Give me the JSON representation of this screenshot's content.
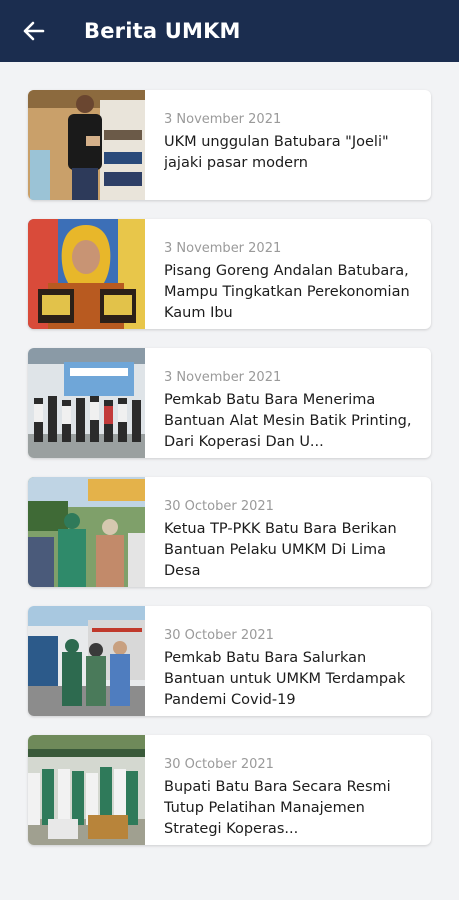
{
  "header": {
    "title": "Berita UMKM",
    "back_icon": "arrow-left-icon"
  },
  "colors": {
    "appbar": "#1b2d4f",
    "background": "#f2f3f5",
    "card": "#ffffff",
    "date_text": "#9a9a9a",
    "title_text": "#1c1c1c"
  },
  "news": [
    {
      "date": "3 November 2021",
      "title": "UKM unggulan Batubara \"Joeli\" jajaki pasar modern"
    },
    {
      "date": "3 November 2021",
      "title": "Pisang Goreng Andalan Batubara, Mampu Tingkatkan Perekonomian Kaum Ibu"
    },
    {
      "date": "3 November 2021",
      "title": "Pemkab Batu Bara Menerima Bantuan Alat Mesin Batik Printing, Dari Koperasi Dan U..."
    },
    {
      "date": "30 October 2021",
      "title": "Ketua TP-PKK Batu Bara Berikan Bantuan Pelaku UMKM Di Lima Desa"
    },
    {
      "date": "30 October 2021",
      "title": "Pemkab Batu Bara Salurkan Bantuan untuk UMKM Terdampak Pandemi Covid-19"
    },
    {
      "date": "30 October 2021",
      "title": "Bupati Batu Bara Secara Resmi Tutup Pelatihan Manajemen Strategi Koperas..."
    }
  ]
}
